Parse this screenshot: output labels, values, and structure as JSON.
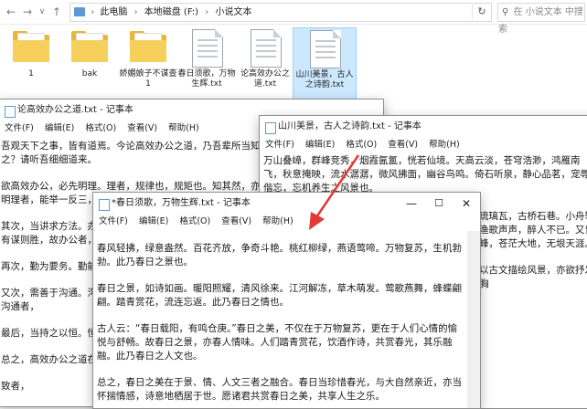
{
  "explorer": {
    "back_arrow": "←",
    "forward_arrow": "→",
    "dropdown": "∨",
    "up_arrow": "↑",
    "breadcrumb": [
      "此电脑",
      "本地磁盘 (F:)",
      "小说文本"
    ],
    "refresh": "↻",
    "search_placeholder": "在 小说文本 中搜索",
    "files": [
      {
        "label": "1",
        "type": "folder"
      },
      {
        "label": "bak",
        "type": "folder"
      },
      {
        "label": "娇媚娘子不谋查1",
        "type": "folder"
      },
      {
        "label": "春日须歌，万物生辉.txt",
        "type": "doc"
      },
      {
        "label": "论高效办公之道.txt",
        "type": "doc"
      },
      {
        "label": "山川美景，古人之诗韵.txt",
        "type": "doc"
      }
    ]
  },
  "notepad_left": {
    "title": "论高效办公之道.txt - 记事本",
    "menu": [
      "文件(F)",
      "编辑(E)",
      "格式(O)",
      "查看(V)",
      "帮助(H)"
    ],
    "paragraphs": [
      "吾观天下之事，皆有道焉。今论高效办公之道，乃吾辈所当知也。吾言不虚。然何以致之？请听吾细细道来。",
      "欲高效办公，必先明理。理者，规律也，规矩也。知其然，亦知其所以然，方能功倍。故明理者，能举一反三，无往而不利。",
      "其次，当讲求方法。办公之事，方法为先。方法得当，事半功倍；方法不当，事倍功半。有谋则胜，故办公者，",
      "再次，勤为要务。勤能补拙，天道酬勤。日积月累，自勤奋工作，积少成多，",
      "又次，需善于沟通。沟通者，人心之桥也。沟通得法，则无往而不利，消除误解。故善于沟通者，",
      "最后，当持之以恒。恒者，成功之母也。坚持不懈，方成大事。坚持，无论困难重重，",
      "总之，高效办公之道在于明理、方法、勤奋、沟通、恒心，践行，以求达成目标，",
      "致者，"
    ]
  },
  "notepad_right": {
    "title": "山川美景，古人之诗韵.txt - 记事本",
    "menu": [
      "文件(F)",
      "编辑(E)",
      "格式(O)",
      "查看(V)",
      "帮助(H)"
    ],
    "paragraphs": [
      "万山叠嶂，群峰竞秀，烟霞氤氲，恍若仙境。天高云淡，苍穹浩渺，鸿雁南飞，秋意掩映，流水潺潺，微风拂面，幽谷鸟鸣。倚石听泉，静心品茗，宠辱偕忘，忘机养生之风景也。",
      "琉璃瓦，古桥石巷。小舟轻渔歌声声，醉人不已。又曾峰，苍茫大地，无垠天涯。",
      "以古文描绘风景，亦欲抒发胸"
    ]
  },
  "notepad_front": {
    "title": "*春日须歌，万物生辉.txt - 记事本",
    "menu": [
      "文件(F)",
      "编辑(E)",
      "格式(O)",
      "查看(V)",
      "帮助(H)"
    ],
    "minimize": "—",
    "maximize": "☐",
    "close": "✕",
    "paragraphs": [
      "春风轻拂，绿意盎然。百花齐放，争奇斗艳。桃红柳绿，燕语莺啼。万物复苏，生机勃勃。此乃春日之景也。",
      "春日之景，如诗如画。暖阳照耀，清风徐来。江河解冻，草木萌发。莺歌燕舞，蜂蝶翩翩。踏青赏花，流连忘返。此乃春日之情也。",
      "古人云：“春日载阳，有鸣仓庚。”春日之美，不仅在于万物复苏，更在于人们心情的愉悦与舒畅。故春日之景，亦春人情味。人们踏青赏花，饮酒作诗，共赏春光，其乐融融。此乃春日之人文也。",
      "总之，春日之美在于景、情、人文三者之融合。春日当珍惜春光，与大自然亲近，亦当怀揣情感，诗意地栖居于世。愿诸君共赏春日之美，共享人生之乐。"
    ]
  },
  "colors": {
    "folder": "#e8b737",
    "selection": "#cce8ff",
    "annotation_arrow": "#e53935"
  }
}
